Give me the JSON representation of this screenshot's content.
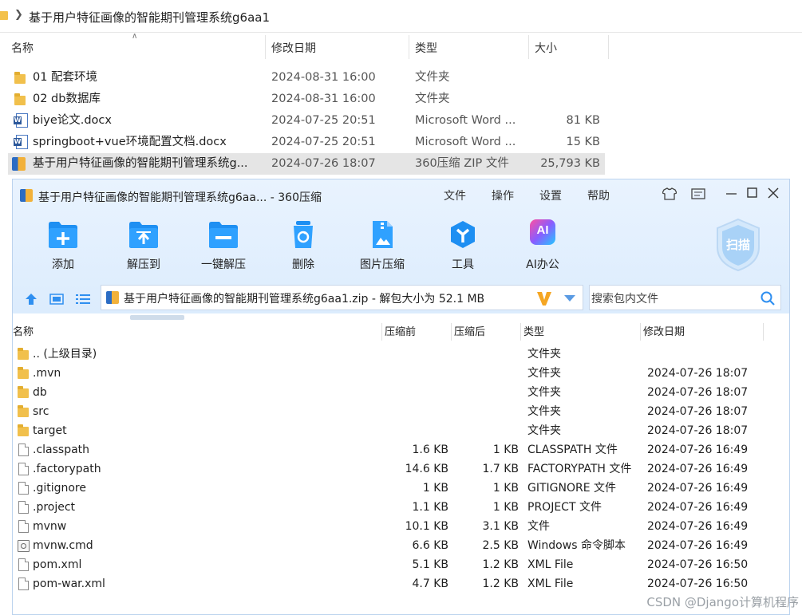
{
  "explorer": {
    "path": "基于用户特征画像的智能期刊管理系统g6aa1",
    "columns": {
      "name": "名称",
      "modified": "修改日期",
      "type": "类型",
      "size": "大小"
    },
    "rows": [
      {
        "name": "01 配套环境",
        "modified": "2024-08-31 16:00",
        "type": "文件夹",
        "size": "",
        "icon": "folder-icon"
      },
      {
        "name": "02 db数据库",
        "modified": "2024-08-31 16:00",
        "type": "文件夹",
        "size": "",
        "icon": "folder-icon"
      },
      {
        "name": "biye论文.docx",
        "modified": "2024-07-25 20:51",
        "type": "Microsoft Word ...",
        "size": "81 KB",
        "icon": "word-doc-icon"
      },
      {
        "name": "springboot+vue环境配置文档.docx",
        "modified": "2024-07-25 20:51",
        "type": "Microsoft Word ...",
        "size": "15 KB",
        "icon": "word-doc-icon"
      },
      {
        "name": "基于用户特征画像的智能期刊管理系统g...",
        "modified": "2024-07-26 18:07",
        "type": "360压缩 ZIP 文件",
        "size": "25,793 KB",
        "icon": "zip-archive-icon",
        "selected": true
      }
    ]
  },
  "app": {
    "title": "基于用户特征画像的智能期刊管理系统g6aa... - 360压缩",
    "menu": [
      "文件",
      "操作",
      "设置",
      "帮助"
    ],
    "toolbar": [
      {
        "label": "添加",
        "icon": "add-icon"
      },
      {
        "label": "解压到",
        "icon": "extract-to-icon"
      },
      {
        "label": "一键解压",
        "icon": "one-click-extract-icon"
      },
      {
        "label": "删除",
        "icon": "delete-icon"
      },
      {
        "label": "图片压缩",
        "icon": "image-compress-icon"
      },
      {
        "label": "工具",
        "icon": "tools-icon"
      },
      {
        "label": "AI办公",
        "icon": "ai-office-icon"
      }
    ],
    "ai_badge": "AI",
    "scan_label": "扫描",
    "address": "基于用户特征画像的智能期刊管理系统g6aa1.zip - 解包大小为 52.1 MB",
    "search_placeholder": "搜索包内文件",
    "columns": {
      "name": "名称",
      "compressed": "压缩前",
      "packed": "压缩后",
      "type": "类型",
      "modified": "修改日期"
    },
    "files": [
      {
        "name": ".. (上级目录)",
        "before": "",
        "after": "",
        "type": "文件夹",
        "modified": "",
        "icon": "folder-icon"
      },
      {
        "name": ".mvn",
        "before": "",
        "after": "",
        "type": "文件夹",
        "modified": "2024-07-26 18:07",
        "icon": "folder-icon"
      },
      {
        "name": "db",
        "before": "",
        "after": "",
        "type": "文件夹",
        "modified": "2024-07-26 18:07",
        "icon": "folder-icon"
      },
      {
        "name": "src",
        "before": "",
        "after": "",
        "type": "文件夹",
        "modified": "2024-07-26 18:07",
        "icon": "folder-icon"
      },
      {
        "name": "target",
        "before": "",
        "after": "",
        "type": "文件夹",
        "modified": "2024-07-26 18:07",
        "icon": "folder-icon"
      },
      {
        "name": ".classpath",
        "before": "1.6 KB",
        "after": "1 KB",
        "type": "CLASSPATH 文件",
        "modified": "2024-07-26 16:49",
        "icon": "file-icon"
      },
      {
        "name": ".factorypath",
        "before": "14.6 KB",
        "after": "1.7 KB",
        "type": "FACTORYPATH 文件",
        "modified": "2024-07-26 16:49",
        "icon": "file-icon"
      },
      {
        "name": ".gitignore",
        "before": "1 KB",
        "after": "1 KB",
        "type": "GITIGNORE 文件",
        "modified": "2024-07-26 16:49",
        "icon": "file-icon"
      },
      {
        "name": ".project",
        "before": "1.1 KB",
        "after": "1 KB",
        "type": "PROJECT 文件",
        "modified": "2024-07-26 16:49",
        "icon": "file-icon"
      },
      {
        "name": "mvnw",
        "before": "10.1 KB",
        "after": "3.1 KB",
        "type": "文件",
        "modified": "2024-07-26 16:49",
        "icon": "file-icon"
      },
      {
        "name": "mvnw.cmd",
        "before": "6.6 KB",
        "after": "2.5 KB",
        "type": "Windows 命令脚本",
        "modified": "2024-07-26 16:49",
        "icon": "cmd-script-icon"
      },
      {
        "name": "pom.xml",
        "before": "5.1 KB",
        "after": "1.2 KB",
        "type": "XML File",
        "modified": "2024-07-26 16:50",
        "icon": "file-icon"
      },
      {
        "name": "pom-war.xml",
        "before": "4.7 KB",
        "after": "1.2 KB",
        "type": "XML File",
        "modified": "2024-07-26 16:50",
        "icon": "file-icon"
      }
    ]
  },
  "watermark": "CSDN @Django计算机程序",
  "colors": {
    "accent": "#1c8ef0",
    "folder": "#f1c04c",
    "window_top": "#e3effd"
  }
}
